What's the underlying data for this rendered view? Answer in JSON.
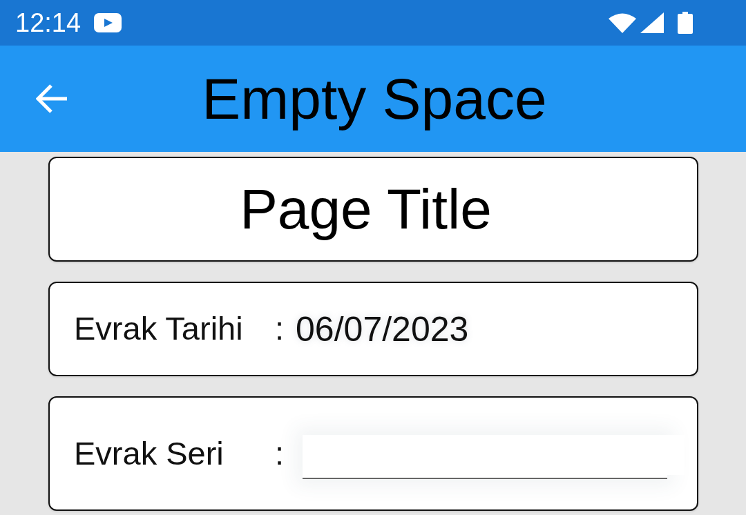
{
  "status_bar": {
    "time": "12:14"
  },
  "app_bar": {
    "title": "Empty Space"
  },
  "page_title": "Page Title",
  "fields": [
    {
      "kind": "text",
      "label": "Evrak Tarihi",
      "separator": ":",
      "value": "06/07/2023"
    },
    {
      "kind": "input",
      "label": "Evrak Seri",
      "separator": ":"
    }
  ]
}
